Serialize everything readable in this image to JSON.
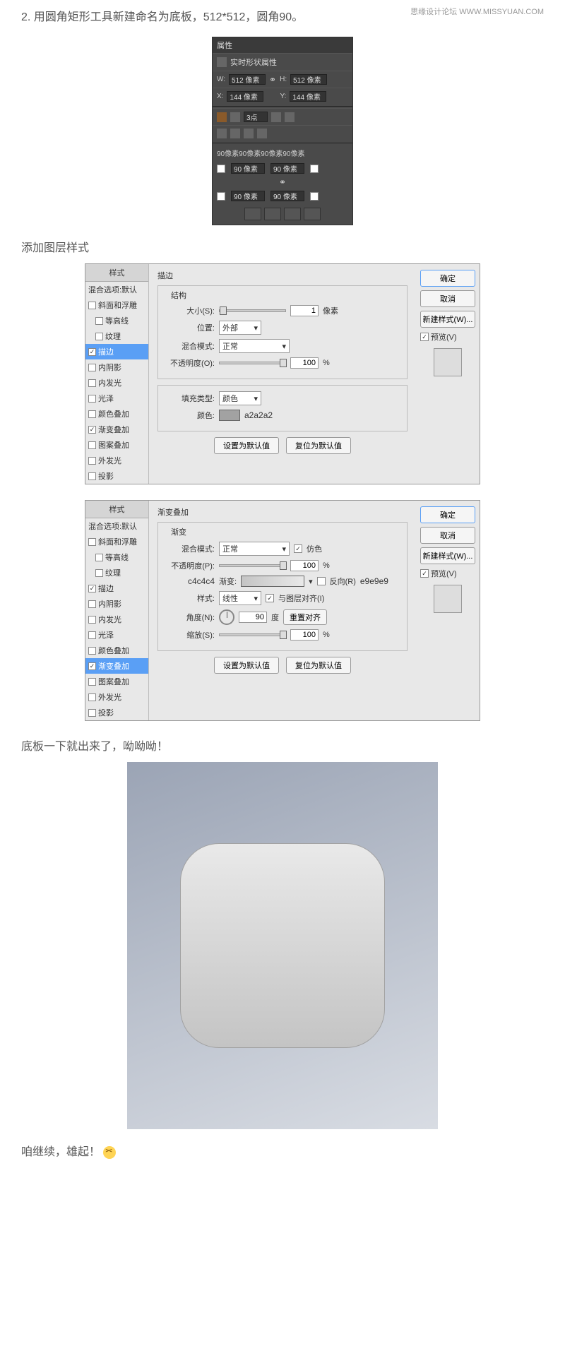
{
  "watermark": "思缘设计论坛  WWW.MISSYUAN.COM",
  "step2": "2. 用圆角矩形工具新建命名为底板，512*512，圆角90。",
  "heading1": "添加图层样式",
  "heading2": "底板一下就出来了，呦呦呦！",
  "heading3": "咱继续，雄起！ ",
  "props": {
    "title": "属性",
    "shape_type": "实时形状属性",
    "w_label": "W:",
    "w": "512 像素",
    "h_label": "H:",
    "h": "512 像素",
    "x_label": "X:",
    "x": "144 像素",
    "y_label": "Y:",
    "y": "144 像素",
    "stroke": "3点",
    "corners_summary": "90像素90像素90像素90像素",
    "corner": "90 像素"
  },
  "dialog": {
    "styles_header": "样式",
    "blending": "混合选项:默认",
    "items": [
      "斜面和浮雕",
      "等高线",
      "纹理",
      "描边",
      "内阴影",
      "内发光",
      "光泽",
      "颜色叠加",
      "渐变叠加",
      "图案叠加",
      "外发光",
      "投影"
    ],
    "ok": "确定",
    "cancel": "取消",
    "new_style": "新建样式(W)...",
    "preview": "预览(V)",
    "make_default": "设置为默认值",
    "reset_default": "复位为默认值"
  },
  "stroke": {
    "title": "描边",
    "structure": "结构",
    "size_label": "大小(S):",
    "size": "1",
    "px": "像素",
    "position_label": "位置:",
    "position": "外部",
    "blend_label": "混合模式:",
    "blend": "正常",
    "opacity_label": "不透明度(O):",
    "opacity": "100",
    "fill_type_label": "填充类型:",
    "fill_type": "颜色",
    "color_label": "颜色:",
    "color_hex": "a2a2a2"
  },
  "grad": {
    "title": "渐变叠加",
    "group": "渐变",
    "blend_label": "混合模式:",
    "blend": "正常",
    "dither": "仿色",
    "opacity_label": "不透明度(P):",
    "opacity": "100",
    "grad_label": "渐变:",
    "color1": "c4c4c4",
    "color2": "e9e9e9",
    "reverse": "反向(R)",
    "style_label": "样式:",
    "style": "线性",
    "align": "与图层对齐(I)",
    "angle_label": "角度(N):",
    "angle": "90",
    "deg": "度",
    "reset_align": "重置对齐",
    "scale_label": "缩放(S):",
    "scale": "100"
  }
}
